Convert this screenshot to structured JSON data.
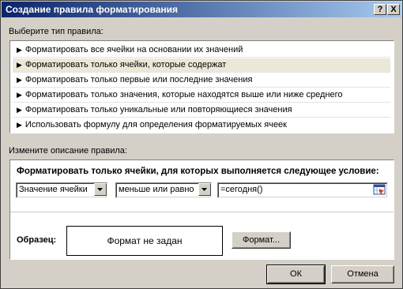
{
  "window": {
    "title": "Создание правила форматирования",
    "help_label": "?",
    "close_label": "X"
  },
  "rule_type": {
    "label": "Выберите тип правила:",
    "items": [
      {
        "label": "Форматировать все ячейки на основании их значений",
        "selected": false
      },
      {
        "label": "Форматировать только ячейки, которые содержат",
        "selected": true
      },
      {
        "label": "Форматировать только первые или последние значения",
        "selected": false
      },
      {
        "label": "Форматировать только значения, которые находятся выше или ниже среднего",
        "selected": false
      },
      {
        "label": "Форматировать только уникальные или повторяющиеся значения",
        "selected": false
      },
      {
        "label": "Использовать формулу для определения форматируемых ячеек",
        "selected": false
      }
    ]
  },
  "description": {
    "label": "Измените описание правила:",
    "title": "Форматировать только ячейки, для которых выполняется следующее условие:",
    "condition_field": "Значение ячейки",
    "operator": "меньше или равно",
    "formula": "=сегодня()",
    "sample_label": "Образец:",
    "sample_text": "Формат не задан",
    "format_button": "Формат..."
  },
  "buttons": {
    "ok": "ОК",
    "cancel": "Отмена"
  },
  "colors": {
    "titlebar_start": "#0a246a",
    "titlebar_end": "#a6caf0",
    "dialog_bg": "#d4d0c8",
    "selected_row": "#ebe8d8"
  }
}
